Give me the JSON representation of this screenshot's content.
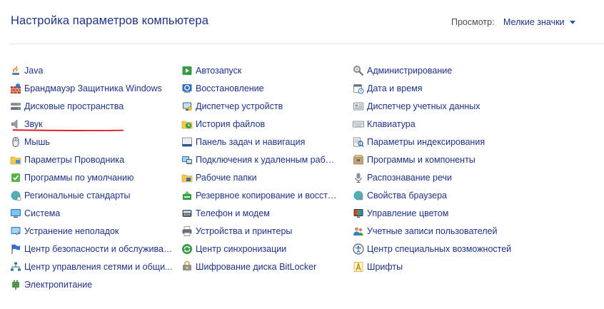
{
  "header": {
    "title": "Настройка параметров компьютера",
    "view_label": "Просмотр:",
    "view_value": "Мелкие значки"
  },
  "columns": [
    [
      {
        "label": "Java",
        "icon": "java-icon"
      },
      {
        "label": "Брандмауэр Защитника Windows",
        "icon": "firewall-icon"
      },
      {
        "label": "Дисковые пространства",
        "icon": "storage-spaces-icon"
      },
      {
        "label": "Звук",
        "icon": "speaker-icon"
      },
      {
        "label": "Мышь",
        "icon": "mouse-icon"
      },
      {
        "label": "Параметры Проводника",
        "icon": "folder-options-icon"
      },
      {
        "label": "Программы по умолчанию",
        "icon": "default-programs-icon"
      },
      {
        "label": "Региональные стандарты",
        "icon": "region-icon"
      },
      {
        "label": "Система",
        "icon": "system-icon"
      },
      {
        "label": "Устранение неполадок",
        "icon": "troubleshooting-icon"
      },
      {
        "label": "Центр безопасности и обслуживан...",
        "icon": "security-flag-icon"
      },
      {
        "label": "Центр управления сетями и общи...",
        "icon": "network-icon"
      },
      {
        "label": "Электропитание",
        "icon": "power-icon"
      }
    ],
    [
      {
        "label": "Автозапуск",
        "icon": "autoplay-icon"
      },
      {
        "label": "Восстановление",
        "icon": "recovery-icon"
      },
      {
        "label": "Диспетчер устройств",
        "icon": "device-manager-icon"
      },
      {
        "label": "История файлов",
        "icon": "file-history-icon"
      },
      {
        "label": "Панель задач и навигация",
        "icon": "taskbar-icon"
      },
      {
        "label": "Подключения к удаленным рабоч...",
        "icon": "remote-desktop-icon"
      },
      {
        "label": "Рабочие папки",
        "icon": "work-folders-icon"
      },
      {
        "label": "Резервное копирование и восстан...",
        "icon": "backup-icon"
      },
      {
        "label": "Телефон и модем",
        "icon": "phone-modem-icon"
      },
      {
        "label": "Устройства и принтеры",
        "icon": "printer-icon"
      },
      {
        "label": "Центр синхронизации",
        "icon": "sync-icon"
      },
      {
        "label": "Шифрование диска BitLocker",
        "icon": "bitlocker-icon"
      }
    ],
    [
      {
        "label": "Администрирование",
        "icon": "admin-tools-icon"
      },
      {
        "label": "Дата и время",
        "icon": "calendar-clock-icon"
      },
      {
        "label": "Диспетчер учетных данных",
        "icon": "credential-manager-icon"
      },
      {
        "label": "Клавиатура",
        "icon": "keyboard-icon"
      },
      {
        "label": "Параметры индексирования",
        "icon": "indexing-icon"
      },
      {
        "label": "Программы и компоненты",
        "icon": "programs-features-icon"
      },
      {
        "label": "Распознавание речи",
        "icon": "microphone-icon"
      },
      {
        "label": "Свойства браузера",
        "icon": "internet-options-icon"
      },
      {
        "label": "Управление цветом",
        "icon": "color-management-icon"
      },
      {
        "label": "Учетные записи пользователей",
        "icon": "user-accounts-icon"
      },
      {
        "label": "Центр специальных возможностей",
        "icon": "ease-of-access-icon"
      },
      {
        "label": "Шрифты",
        "icon": "fonts-icon"
      }
    ]
  ],
  "colors": {
    "link": "#1e3287",
    "annotation": "#d9151b"
  }
}
